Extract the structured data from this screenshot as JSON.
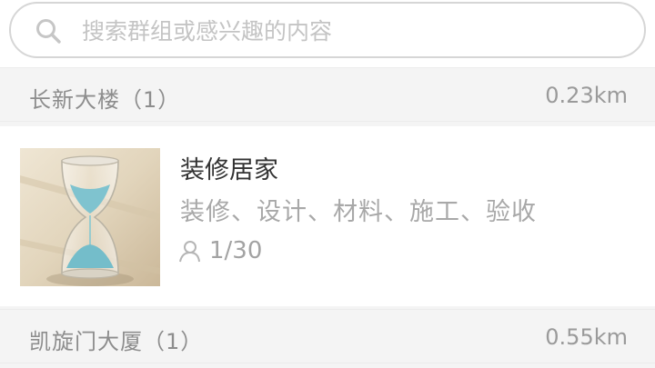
{
  "search": {
    "placeholder": "搜索群组或感兴趣的内容",
    "icon": "search-icon"
  },
  "sections": [
    {
      "name": "长新大楼（1）",
      "distance": "0.23km",
      "groups": [
        {
          "title": "装修居家",
          "tags": "装修、设计、材料、施工、验收",
          "members": "1/30",
          "member_icon": "person-icon",
          "thumbnail": "hourglass-image"
        }
      ]
    },
    {
      "name": "凯旋门大厦（1）",
      "distance": "0.55km"
    }
  ],
  "colors": {
    "background": "#f4f4f4",
    "card": "#ffffff",
    "title_text": "#333333",
    "secondary_text": "#a8a8a8",
    "search_border": "#d6d6d6"
  }
}
